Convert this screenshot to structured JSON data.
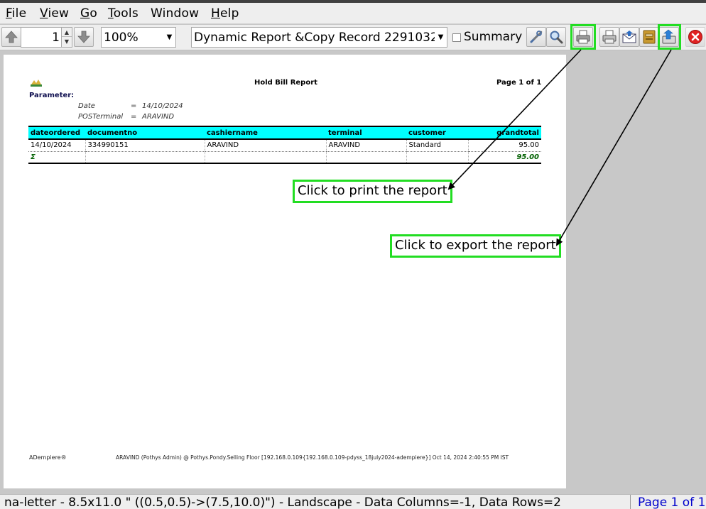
{
  "menu": {
    "file": {
      "first": "F",
      "rest": "ile"
    },
    "view": {
      "first": "V",
      "rest": "iew"
    },
    "go": {
      "first": "G",
      "rest": "o"
    },
    "tools": {
      "first": "T",
      "rest": "ools"
    },
    "window": {
      "first": "",
      "rest": "Window"
    },
    "help": {
      "first": "H",
      "rest": "elp"
    }
  },
  "toolbar": {
    "page_number": "1",
    "zoom": "100%",
    "report_view": "Dynamic Report &Copy Record 2291032",
    "summary_label": "Summary",
    "summary_checked": false,
    "icons": [
      "previous-page-icon",
      "next-page-icon",
      "customize-icon",
      "find-icon",
      "print-icon",
      "export-pdf-icon",
      "send-mail-icon",
      "archive-icon",
      "export-icon",
      "close-icon"
    ]
  },
  "report": {
    "title": "Hold Bill Report",
    "page_info": "Page 1 of 1",
    "parameter_label": "Parameter:",
    "parameters": [
      {
        "name": "Date",
        "op": "=",
        "value": "14/10/2024"
      },
      {
        "name": "POSTerminal",
        "op": "=",
        "value": "ARAVIND"
      }
    ],
    "columns": [
      "dateordered",
      "documentno",
      "cashiername",
      "terminal",
      "customer",
      "grandtotal"
    ],
    "rows": [
      [
        "14/10/2024",
        "334990151",
        "ARAVIND",
        "ARAVIND",
        "Standard",
        "95.00"
      ]
    ],
    "total_row": {
      "symbol": "Σ",
      "grandtotal": "95.00"
    },
    "footer_left": "ADempiere®",
    "footer_center": "ARAVIND (Pothys Admin) @ Pothys.Pondy.Selling Floor [192.168.0.109{192.168.0.109-pdyss_18july2024-adempiere}] Oct 14, 2024 2:40:55 PM IST"
  },
  "callouts": {
    "print": "Click to print the report",
    "export": "Click to export the report"
  },
  "colors": {
    "header_band": "#00ffff",
    "highlight": "#22dd22",
    "total_text": "#006000",
    "status_page_text": "#0000cc"
  },
  "status": {
    "text": "na-letter - 8.5x11.0 \" ((0.5,0.5)->(7.5,10.0)\") - Landscape - Data Columns=-1, Data Rows=2",
    "page": "Page 1 of 1"
  }
}
